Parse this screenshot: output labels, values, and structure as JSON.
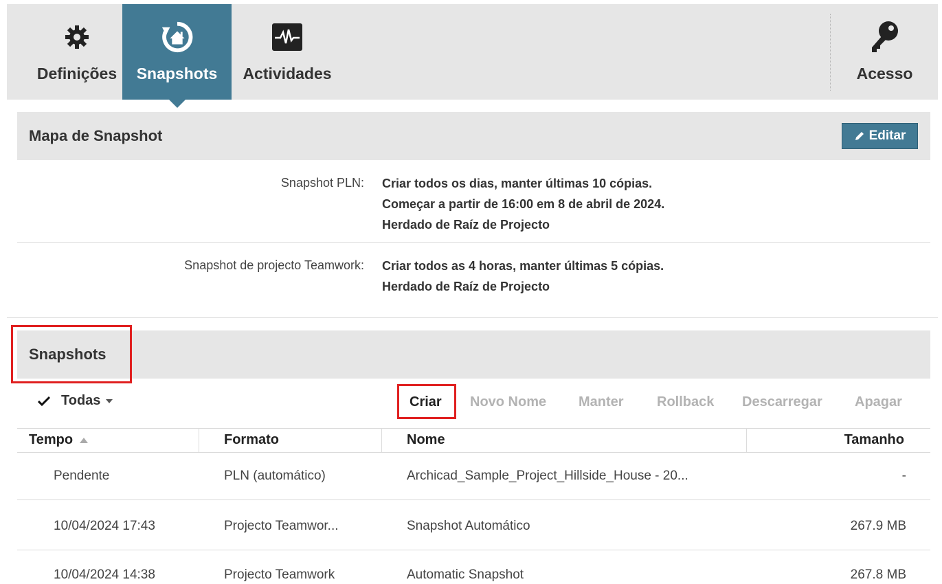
{
  "toolbar": {
    "items": [
      {
        "label": "Definições",
        "icon": "gear-icon"
      },
      {
        "label": "Snapshots",
        "icon": "snapshot-restore-icon",
        "active": true
      },
      {
        "label": "Actividades",
        "icon": "activity-monitor-icon"
      }
    ],
    "access": {
      "label": "Acesso",
      "icon": "key-icon"
    }
  },
  "snapshot_map": {
    "title": "Mapa de Snapshot",
    "edit_label": "Editar",
    "rows": [
      {
        "label": "Snapshot PLN:",
        "lines": [
          "Criar todos os dias, manter últimas 10 cópias.",
          "Começar a partir de 16:00 em 8 de abril de 2024.",
          "Herdado de Raíz de Projecto"
        ]
      },
      {
        "label": "Snapshot de projecto Teamwork:",
        "lines": [
          "Criar todos as 4 horas, manter últimas 5 cópias.",
          "Herdado de Raíz de Projecto"
        ]
      }
    ]
  },
  "snapshots": {
    "title": "Snapshots",
    "filter_label": "Todas",
    "actions": [
      {
        "label": "Criar",
        "enabled": true
      },
      {
        "label": "Novo Nome",
        "enabled": false
      },
      {
        "label": "Manter",
        "enabled": false
      },
      {
        "label": "Rollback",
        "enabled": false
      },
      {
        "label": "Descarregar",
        "enabled": false
      },
      {
        "label": "Apagar",
        "enabled": false
      }
    ],
    "columns": [
      "Tempo",
      "Formato",
      "Nome",
      "Tamanho"
    ],
    "rows": [
      {
        "time": "Pendente",
        "format": "PLN (automático)",
        "name": "Archicad_Sample_Project_Hillside_House - 20...",
        "size": "-"
      },
      {
        "time": "10/04/2024 17:43",
        "format": "Projecto Teamwor...",
        "name": "Snapshot Automático",
        "size": "267.9 MB"
      },
      {
        "time": "10/04/2024 14:38",
        "format": "Projecto Teamwork",
        "name": "Automatic Snapshot",
        "size": "267.8 MB"
      }
    ]
  },
  "colors": {
    "accent": "#427a94",
    "highlight": "#e02020",
    "bar": "#e6e6e6"
  }
}
